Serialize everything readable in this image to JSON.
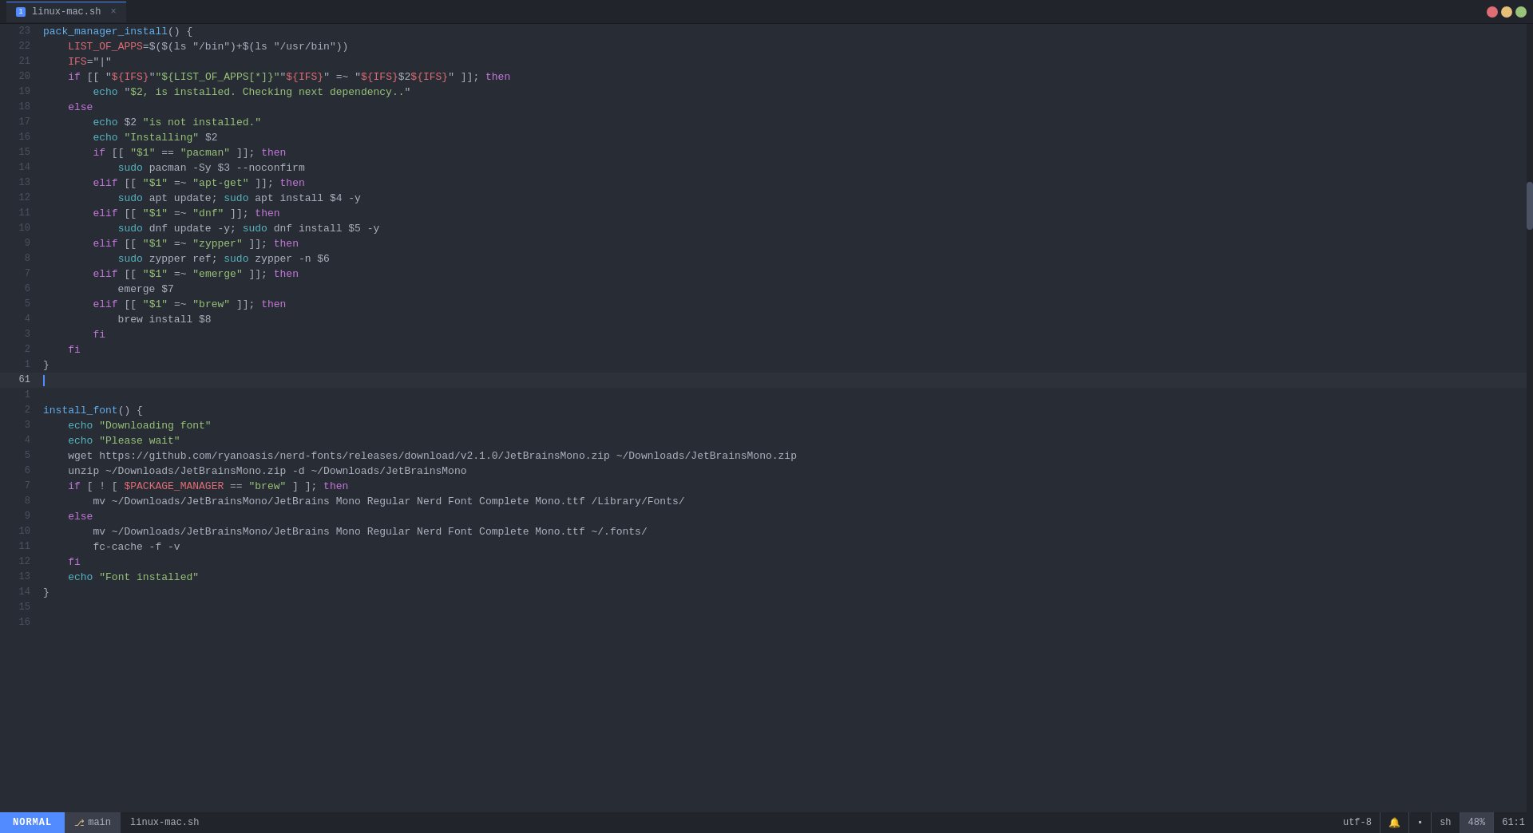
{
  "titlebar": {
    "tab_label": "linux-mac.sh",
    "tab_icon": "1",
    "close_label": "×"
  },
  "statusbar": {
    "mode": "NORMAL",
    "branch_icon": "⎇",
    "branch": "main",
    "filename": "linux-mac.sh",
    "encoding": "utf-8",
    "format": "sh",
    "percent": "48%",
    "position": "61:1"
  },
  "code_sections": {
    "section1_title": "pack_manager_install function (reversed lines 23..1)",
    "section2_title": "install_font function"
  }
}
